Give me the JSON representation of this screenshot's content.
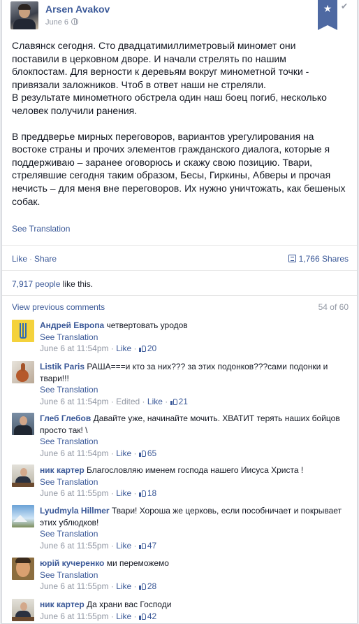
{
  "post": {
    "author": "Arsen Avakov",
    "date": "June 6",
    "paragraph1_lines": [
      "Славянск сегодня. Сто двадцатимиллиметровый миномет они",
      "поставили в церковном дворе. И начали стрелять по нашим",
      "блокпостам. Для верности к деревьям вокруг минометной точки -",
      "привязали заложников. Чтоб в ответ наши не стреляли.",
      "В результате минометного обстрела один наш боец погиб, несколько",
      "человек получили ранения."
    ],
    "paragraph2_lines": [
      "В преддверье мирных переговоров, вариантов урегулирования на",
      "востоке страны и прочих элементов гражданского диалога, которые я",
      "поддерживаю – заранее оговорюсь и скажу свою позицию. Твари,",
      "стрелявшие сегодня таким образом, Бесы, Гиркины, Абверы и прочая",
      "нечисть – для меня вне переговоров. Их нужно уничтожать, как бешеных",
      "собак."
    ],
    "see_translation": "See Translation"
  },
  "actions": {
    "like": "Like",
    "dot": "·",
    "share": "Share",
    "shares_count": "1,766 Shares"
  },
  "likes": {
    "count": "7,917 people",
    "rest": " like this."
  },
  "comments_header": {
    "view_previous": "View previous comments",
    "pager": "54 of 60"
  },
  "comments": [
    {
      "name": "Андрей Европа",
      "text": " четвертовать уродов",
      "see_translation": "See Translation",
      "time": "June 6 at 11:54pm",
      "edited": "",
      "like": "Like",
      "likes": "20",
      "avatar_icon": "trident-icon"
    },
    {
      "name": "Listik Paris",
      "text": " РАША===и кто за них??? за этих подонков???сами подонки и твари!!!",
      "see_translation": "See Translation",
      "time": "June 6 at 11:54pm",
      "edited": " · Edited",
      "like": "Like",
      "likes": "21",
      "avatar_icon": "squirrel-icon"
    },
    {
      "name": "Глеб Глебов",
      "text": " Давайте уже, начинайте мочить. ХВАТИТ терять наших бойцов просто так! \\",
      "see_translation": "See Translation",
      "time": "June 6 at 11:54pm",
      "edited": "",
      "like": "Like",
      "likes": "65",
      "avatar_icon": "man-icon"
    },
    {
      "name": "ник картер",
      "text": " Благословляю именем господа нашего Иисуса Христа !",
      "see_translation": "See Translation",
      "time": "June 6 at 11:55pm",
      "edited": "",
      "like": "Like",
      "likes": "18",
      "avatar_icon": "office-man-icon"
    },
    {
      "name": "Lyudmyla Hillmer",
      "text": " Твари! Хороша же церковь, если пособничает и покрывает этих ублюдков!",
      "see_translation": "See Translation",
      "time": "June 6 at 11:55pm",
      "edited": "",
      "like": "Like",
      "likes": "47",
      "avatar_icon": "mountain-icon"
    },
    {
      "name": "юрій кучеренко",
      "text": " ми переможемо",
      "see_translation": "See Translation",
      "time": "June 6 at 11:55pm",
      "edited": "",
      "like": "Like",
      "likes": "28",
      "avatar_icon": "face-icon"
    },
    {
      "name": "ник картер",
      "text": " Да храни вас Господи",
      "see_translation": "",
      "time": "June 6 at 11:55pm",
      "edited": "",
      "like": "Like",
      "likes": "42",
      "avatar_icon": "office-man-icon"
    }
  ],
  "colors": {
    "link": "#3b5998",
    "meta": "#9197a3",
    "text": "#141823",
    "bookmark": "#4e69a2"
  }
}
